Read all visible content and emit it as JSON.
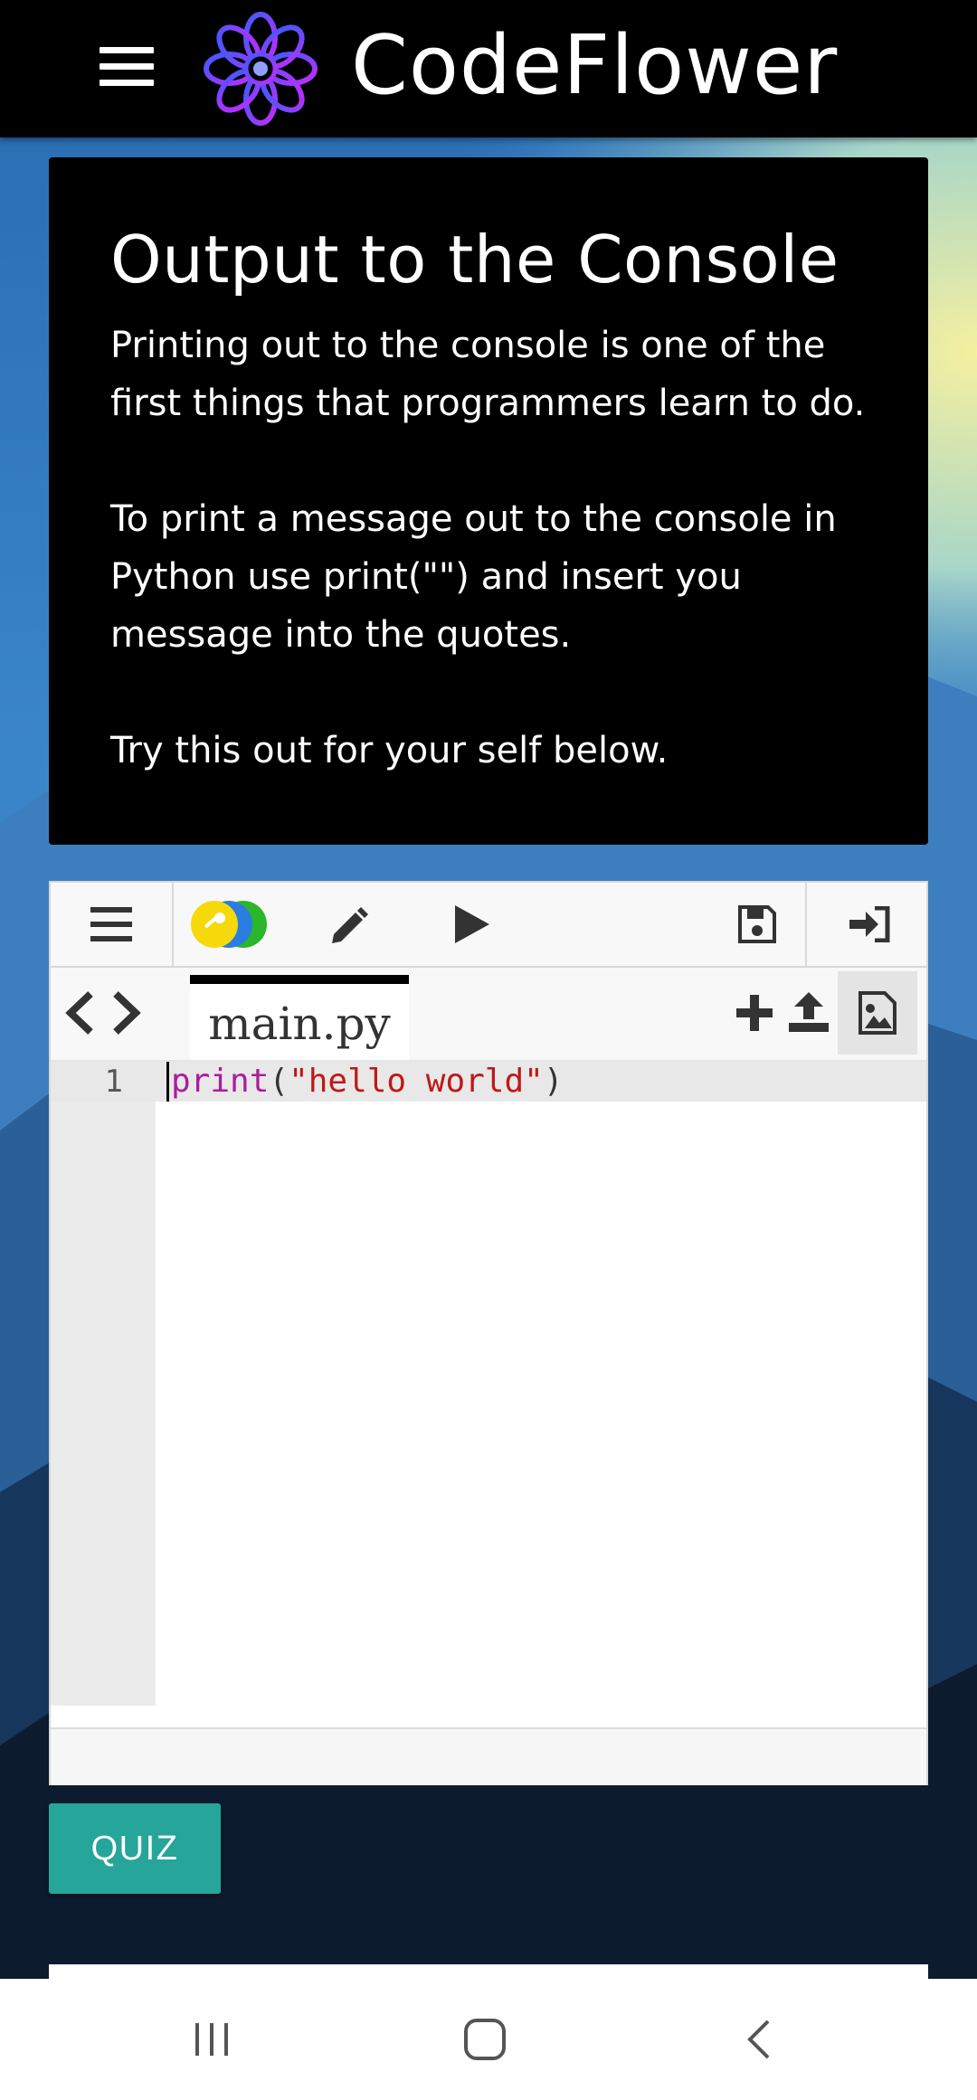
{
  "app": {
    "title": "CodeFlower"
  },
  "lesson": {
    "title": "Output to the Console",
    "paragraphs": [
      "Printing out to the console is one of the first things that programmers learn to do.",
      "To print a message out to the console in Python use print(\"\") and insert you message into the quotes.",
      "Try this out for your self below."
    ]
  },
  "editor": {
    "toolbar": {
      "icons": [
        "menu-icon",
        "key-toggle-icon",
        "pencil-icon",
        "play-icon",
        "save-icon",
        "sign-in-icon"
      ]
    },
    "tab": {
      "filename": "main.py"
    },
    "tab_icons": [
      "code-arrows-icon",
      "plus-icon",
      "upload-icon",
      "image-icon"
    ],
    "code": {
      "line_number": "1",
      "func": "print",
      "open_paren": "(",
      "string": "\"hello world\"",
      "close_paren": ")"
    }
  },
  "quiz_button": {
    "label": "QUIZ"
  },
  "colors": {
    "appbar": "#000000",
    "card": "#000000",
    "quiz": "#26a69a",
    "string": "#c01818",
    "keyword": "#aa1d9c"
  }
}
